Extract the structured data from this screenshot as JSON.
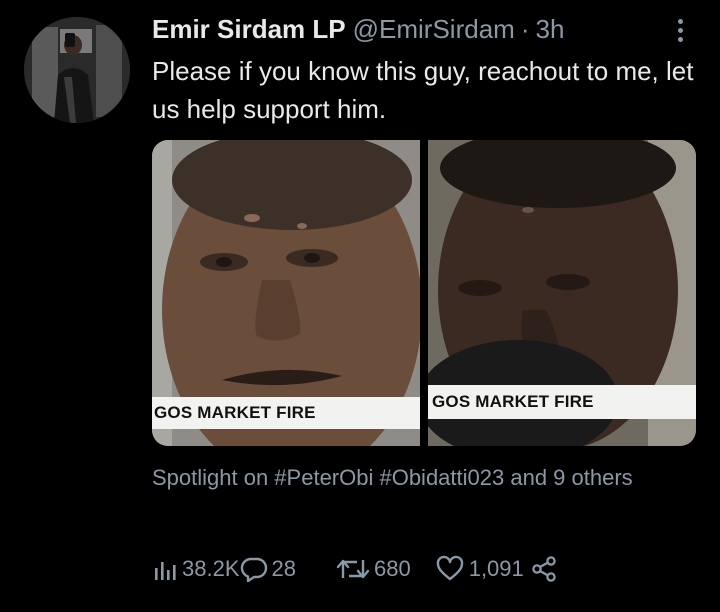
{
  "author": {
    "display_name": "Emir Sirdam LP",
    "handle": "@EmirSirdam",
    "separator": "·",
    "timestamp": "3h"
  },
  "tweet": {
    "text": "Please if you know this guy, reachout to me, let us help support him."
  },
  "media": [
    {
      "caption": "GOS MARKET FIRE"
    },
    {
      "caption": "GOS MARKET FIRE"
    }
  ],
  "spotlight": "Spotlight on #PeterObi #Obidatti023 and 9 others",
  "actions": {
    "views": "38.2K",
    "replies": "28",
    "retweets": "680",
    "likes": "1,091"
  },
  "icons": [
    "views-icon",
    "reply-icon",
    "retweet-icon",
    "like-icon",
    "share-icon",
    "more-icon"
  ],
  "colors": {
    "background": "#000000",
    "primary_text": "#e7e9ea",
    "secondary_text": "#8b98a5",
    "caption_bar": "#f2f2f0"
  }
}
